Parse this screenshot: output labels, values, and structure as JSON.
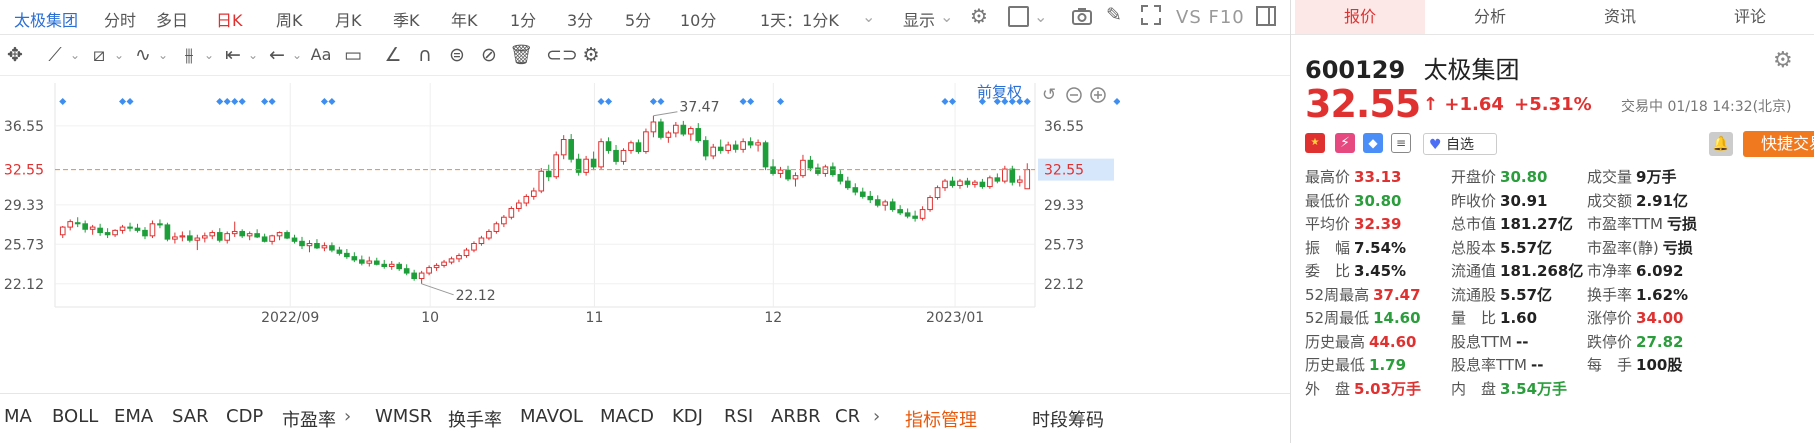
{
  "toolbar": {
    "stock_name": "太极集团",
    "periods": [
      "分时",
      "多日",
      "日K",
      "周K",
      "月K",
      "季K",
      "年K",
      "1分",
      "3分",
      "5分",
      "10分",
      "1天：1分K"
    ],
    "active_period": "日K",
    "display_label": "显示",
    "vs_label": "VS F10"
  },
  "chart_header": {
    "adjust_label": "前复权"
  },
  "chart_data": {
    "type": "candlestick",
    "x_tick_labels": [
      "2022/09",
      "10",
      "11",
      "12",
      "2023/01"
    ],
    "y_ticks": [
      36.55,
      32.55,
      29.33,
      25.73,
      22.12
    ],
    "y_tick_labels": [
      "36.55",
      "32.55",
      "29.33",
      "25.73",
      "22.12"
    ],
    "current_price_label": "32.55",
    "ylim": [
      20.0,
      39.0
    ],
    "annotations": [
      {
        "label": "37.47",
        "value": 37.47
      },
      {
        "label": "22.12",
        "value": 22.12
      }
    ],
    "candles_ohlc": [
      [
        26.6,
        27.4,
        26.3,
        27.3
      ],
      [
        27.3,
        28.0,
        27.0,
        27.8
      ],
      [
        27.7,
        28.2,
        27.3,
        27.6
      ],
      [
        27.6,
        27.9,
        26.8,
        27.1
      ],
      [
        27.1,
        27.5,
        26.6,
        27.3
      ],
      [
        27.2,
        27.6,
        26.5,
        26.8
      ],
      [
        26.8,
        27.2,
        26.3,
        26.6
      ],
      [
        26.6,
        27.1,
        26.4,
        27.0
      ],
      [
        27.0,
        27.5,
        26.7,
        27.3
      ],
      [
        27.3,
        27.7,
        26.9,
        27.2
      ],
      [
        27.2,
        27.6,
        26.8,
        27.0
      ],
      [
        27.0,
        27.3,
        26.2,
        26.5
      ],
      [
        26.5,
        27.9,
        26.3,
        27.6
      ],
      [
        27.6,
        28.0,
        27.2,
        27.5
      ],
      [
        27.5,
        27.7,
        26.0,
        26.2
      ],
      [
        26.2,
        26.8,
        25.8,
        26.4
      ],
      [
        26.4,
        26.9,
        26.0,
        26.5
      ],
      [
        26.5,
        27.0,
        25.9,
        26.1
      ],
      [
        26.1,
        26.6,
        25.2,
        26.3
      ],
      [
        26.3,
        26.8,
        25.9,
        26.5
      ],
      [
        26.5,
        27.0,
        26.2,
        26.8
      ],
      [
        26.8,
        27.2,
        25.9,
        26.1
      ],
      [
        26.1,
        26.9,
        25.8,
        26.7
      ],
      [
        26.7,
        27.8,
        26.4,
        26.9
      ],
      [
        26.9,
        27.1,
        26.3,
        26.5
      ],
      [
        26.5,
        26.9,
        26.1,
        26.7
      ],
      [
        26.7,
        27.1,
        26.3,
        26.4
      ],
      [
        26.4,
        26.7,
        25.9,
        26.0
      ],
      [
        26.0,
        26.6,
        25.7,
        26.5
      ],
      [
        26.5,
        26.9,
        26.1,
        26.8
      ],
      [
        26.8,
        27.0,
        26.2,
        26.3
      ],
      [
        26.3,
        26.6,
        25.8,
        26.0
      ],
      [
        26.0,
        26.4,
        25.3,
        25.6
      ],
      [
        25.6,
        26.1,
        25.0,
        25.8
      ],
      [
        25.8,
        26.2,
        25.3,
        25.4
      ],
      [
        25.4,
        25.9,
        25.1,
        25.6
      ],
      [
        25.6,
        25.9,
        25.0,
        25.2
      ],
      [
        25.2,
        25.5,
        24.7,
        24.9
      ],
      [
        24.9,
        25.3,
        24.4,
        24.6
      ],
      [
        24.6,
        25.0,
        24.1,
        24.3
      ],
      [
        24.3,
        24.7,
        23.8,
        24.0
      ],
      [
        24.0,
        24.6,
        23.7,
        24.2
      ],
      [
        24.2,
        24.5,
        23.8,
        23.9
      ],
      [
        23.9,
        24.3,
        23.5,
        23.7
      ],
      [
        23.7,
        24.2,
        23.4,
        23.9
      ],
      [
        23.9,
        24.1,
        23.3,
        23.5
      ],
      [
        23.5,
        23.9,
        22.9,
        23.1
      ],
      [
        23.1,
        23.4,
        22.4,
        22.6
      ],
      [
        22.6,
        23.3,
        22.12,
        23.1
      ],
      [
        23.1,
        23.8,
        22.9,
        23.6
      ],
      [
        23.6,
        24.0,
        23.3,
        23.8
      ],
      [
        23.8,
        24.3,
        23.6,
        24.1
      ],
      [
        24.1,
        24.6,
        23.9,
        24.4
      ],
      [
        24.4,
        24.9,
        24.1,
        24.7
      ],
      [
        24.7,
        25.4,
        24.5,
        25.2
      ],
      [
        25.2,
        26.0,
        25.0,
        25.8
      ],
      [
        25.8,
        26.5,
        25.6,
        26.3
      ],
      [
        26.3,
        27.1,
        26.1,
        26.9
      ],
      [
        26.9,
        27.8,
        26.7,
        27.6
      ],
      [
        27.6,
        28.4,
        27.3,
        28.2
      ],
      [
        28.2,
        29.2,
        28.0,
        29.0
      ],
      [
        29.0,
        29.8,
        28.7,
        29.5
      ],
      [
        29.5,
        30.3,
        29.2,
        30.1
      ],
      [
        30.1,
        30.9,
        29.8,
        30.6
      ],
      [
        30.6,
        32.7,
        30.4,
        32.4
      ],
      [
        32.4,
        33.0,
        31.5,
        31.9
      ],
      [
        31.9,
        34.2,
        31.7,
        33.9
      ],
      [
        33.9,
        35.7,
        33.5,
        35.3
      ],
      [
        35.3,
        35.8,
        33.2,
        33.5
      ],
      [
        33.5,
        34.0,
        32.0,
        32.3
      ],
      [
        32.3,
        33.8,
        32.0,
        33.5
      ],
      [
        33.5,
        34.2,
        32.5,
        32.8
      ],
      [
        32.8,
        35.4,
        32.6,
        35.1
      ],
      [
        35.1,
        35.5,
        34.0,
        34.3
      ],
      [
        34.3,
        34.8,
        33.0,
        33.3
      ],
      [
        33.3,
        34.5,
        33.0,
        34.3
      ],
      [
        34.3,
        35.2,
        34.0,
        35.0
      ],
      [
        35.0,
        35.3,
        34.0,
        34.2
      ],
      [
        34.2,
        36.3,
        34.0,
        36.0
      ],
      [
        36.0,
        37.47,
        35.5,
        36.9
      ],
      [
        36.9,
        37.2,
        35.3,
        35.5
      ],
      [
        35.5,
        36.1,
        35.0,
        35.9
      ],
      [
        35.9,
        36.9,
        35.5,
        36.6
      ],
      [
        36.6,
        37.0,
        35.6,
        35.8
      ],
      [
        35.8,
        36.5,
        35.2,
        36.3
      ],
      [
        36.3,
        36.8,
        35.0,
        35.2
      ],
      [
        35.2,
        35.6,
        33.4,
        33.8
      ],
      [
        33.8,
        34.9,
        33.5,
        34.6
      ],
      [
        34.6,
        35.3,
        34.0,
        34.3
      ],
      [
        34.3,
        35.1,
        34.0,
        34.8
      ],
      [
        34.8,
        35.2,
        34.1,
        34.4
      ],
      [
        34.4,
        35.4,
        34.1,
        35.1
      ],
      [
        35.1,
        35.5,
        34.5,
        34.8
      ],
      [
        34.8,
        35.3,
        34.2,
        35.0
      ],
      [
        35.0,
        35.2,
        32.5,
        32.8
      ],
      [
        32.8,
        33.5,
        32.0,
        32.2
      ],
      [
        32.2,
        32.8,
        31.8,
        32.5
      ],
      [
        32.5,
        32.9,
        31.5,
        31.7
      ],
      [
        31.7,
        32.3,
        31.0,
        32.0
      ],
      [
        32.0,
        33.9,
        31.8,
        33.4
      ],
      [
        33.4,
        33.8,
        32.4,
        32.7
      ],
      [
        32.7,
        33.1,
        32.0,
        32.2
      ],
      [
        32.2,
        33.0,
        31.9,
        32.8
      ],
      [
        32.8,
        33.2,
        31.9,
        32.1
      ],
      [
        32.1,
        32.5,
        31.2,
        31.5
      ],
      [
        31.5,
        31.9,
        30.7,
        30.9
      ],
      [
        30.9,
        31.3,
        30.2,
        30.5
      ],
      [
        30.5,
        30.9,
        29.9,
        30.1
      ],
      [
        30.1,
        30.6,
        29.5,
        29.8
      ],
      [
        29.8,
        30.2,
        29.1,
        29.3
      ],
      [
        29.3,
        29.8,
        28.8,
        29.6
      ],
      [
        29.6,
        29.9,
        28.7,
        28.9
      ],
      [
        28.9,
        29.3,
        28.4,
        28.6
      ],
      [
        28.6,
        29.0,
        28.1,
        28.3
      ],
      [
        28.3,
        28.8,
        27.8,
        28.1
      ],
      [
        28.1,
        29.2,
        27.9,
        28.9
      ],
      [
        28.9,
        30.2,
        28.7,
        30.0
      ],
      [
        30.0,
        31.1,
        29.8,
        30.9
      ],
      [
        30.9,
        31.7,
        30.6,
        31.5
      ],
      [
        31.5,
        31.9,
        30.9,
        31.1
      ],
      [
        31.1,
        31.7,
        30.8,
        31.5
      ],
      [
        31.5,
        31.8,
        30.9,
        31.2
      ],
      [
        31.2,
        31.6,
        30.9,
        31.4
      ],
      [
        31.4,
        31.7,
        30.8,
        31.0
      ],
      [
        31.0,
        32.0,
        30.8,
        31.8
      ],
      [
        31.8,
        32.2,
        31.3,
        31.5
      ],
      [
        31.5,
        32.9,
        31.3,
        32.6
      ],
      [
        32.6,
        32.9,
        31.1,
        31.4
      ],
      [
        31.4,
        32.0,
        31.0,
        31.6
      ],
      [
        30.8,
        33.13,
        30.8,
        32.55
      ]
    ]
  },
  "indicators": [
    "MA",
    "BOLL",
    "EMA",
    "SAR",
    "CDP",
    "市盈率",
    "WMSR",
    "换手率",
    "MAVOL",
    "MACD",
    "KDJ",
    "RSI",
    "ARBR",
    "CR"
  ],
  "indicator_manage_label": "指标管理",
  "indicator_right": [
    "时段",
    "筹码"
  ],
  "sidebar": {
    "tabs": [
      "报价",
      "分析",
      "资讯",
      "评论"
    ],
    "active_tab": "报价",
    "code": "600129",
    "name": "太极集团",
    "price": "32.55",
    "change": "+1.64",
    "change_pct": "+5.31%",
    "status": "交易中 01/18 14:32(北京)",
    "watch_label": "自选",
    "quick_trade_label": "快捷交易",
    "quotes": [
      [
        {
          "l": "最高价",
          "v": "33.13",
          "c": "red"
        },
        {
          "l": "开盘价",
          "v": "30.80",
          "c": "grn"
        },
        {
          "l": "成交量",
          "v": "9万手",
          "c": ""
        }
      ],
      [
        {
          "l": "最低价",
          "v": "30.80",
          "c": "grn"
        },
        {
          "l": "昨收价",
          "v": "30.91",
          "c": ""
        },
        {
          "l": "成交额",
          "v": "2.91亿",
          "c": ""
        }
      ],
      [
        {
          "l": "平均价",
          "v": "32.39",
          "c": "red"
        },
        {
          "l": "总市值",
          "v": "181.27亿",
          "c": ""
        },
        {
          "l": "市盈率TTM",
          "v": "亏损",
          "c": ""
        }
      ],
      [
        {
          "l": "振　幅",
          "v": "7.54%",
          "c": ""
        },
        {
          "l": "总股本",
          "v": "5.57亿",
          "c": ""
        },
        {
          "l": "市盈率(静)",
          "v": "亏损",
          "c": ""
        }
      ],
      [
        {
          "l": "委　比",
          "v": "3.45%",
          "c": ""
        },
        {
          "l": "流通值",
          "v": "181.268亿",
          "c": ""
        },
        {
          "l": "市净率",
          "v": "6.092",
          "c": ""
        }
      ],
      [
        {
          "l": "52周最高",
          "v": "37.47",
          "c": "red"
        },
        {
          "l": "流通股",
          "v": "5.57亿",
          "c": ""
        },
        {
          "l": "换手率",
          "v": "1.62%",
          "c": ""
        }
      ],
      [
        {
          "l": "52周最低",
          "v": "14.60",
          "c": "grn"
        },
        {
          "l": "量　比",
          "v": "1.60",
          "c": ""
        },
        {
          "l": "涨停价",
          "v": "34.00",
          "c": "red"
        }
      ],
      [
        {
          "l": "历史最高",
          "v": "44.60",
          "c": "red"
        },
        {
          "l": "股息TTM",
          "v": "--",
          "c": ""
        },
        {
          "l": "跌停价",
          "v": "27.82",
          "c": "grn"
        }
      ],
      [
        {
          "l": "历史最低",
          "v": "1.79",
          "c": "grn"
        },
        {
          "l": "股息率TTM",
          "v": "--",
          "c": ""
        },
        {
          "l": "每　手",
          "v": "100股",
          "c": ""
        }
      ],
      [
        {
          "l": "外　盘",
          "v": "5.03万手",
          "c": "red"
        },
        {
          "l": "内　盘",
          "v": "3.54万手",
          "c": "grn"
        },
        {
          "l": "",
          "v": "",
          "c": ""
        }
      ]
    ]
  },
  "colors": {
    "up": "#e03131",
    "down": "#1e9e3a",
    "accent": "#2a6fd6",
    "price_line": "#f08c2e",
    "marker": "#3d8ef0"
  }
}
